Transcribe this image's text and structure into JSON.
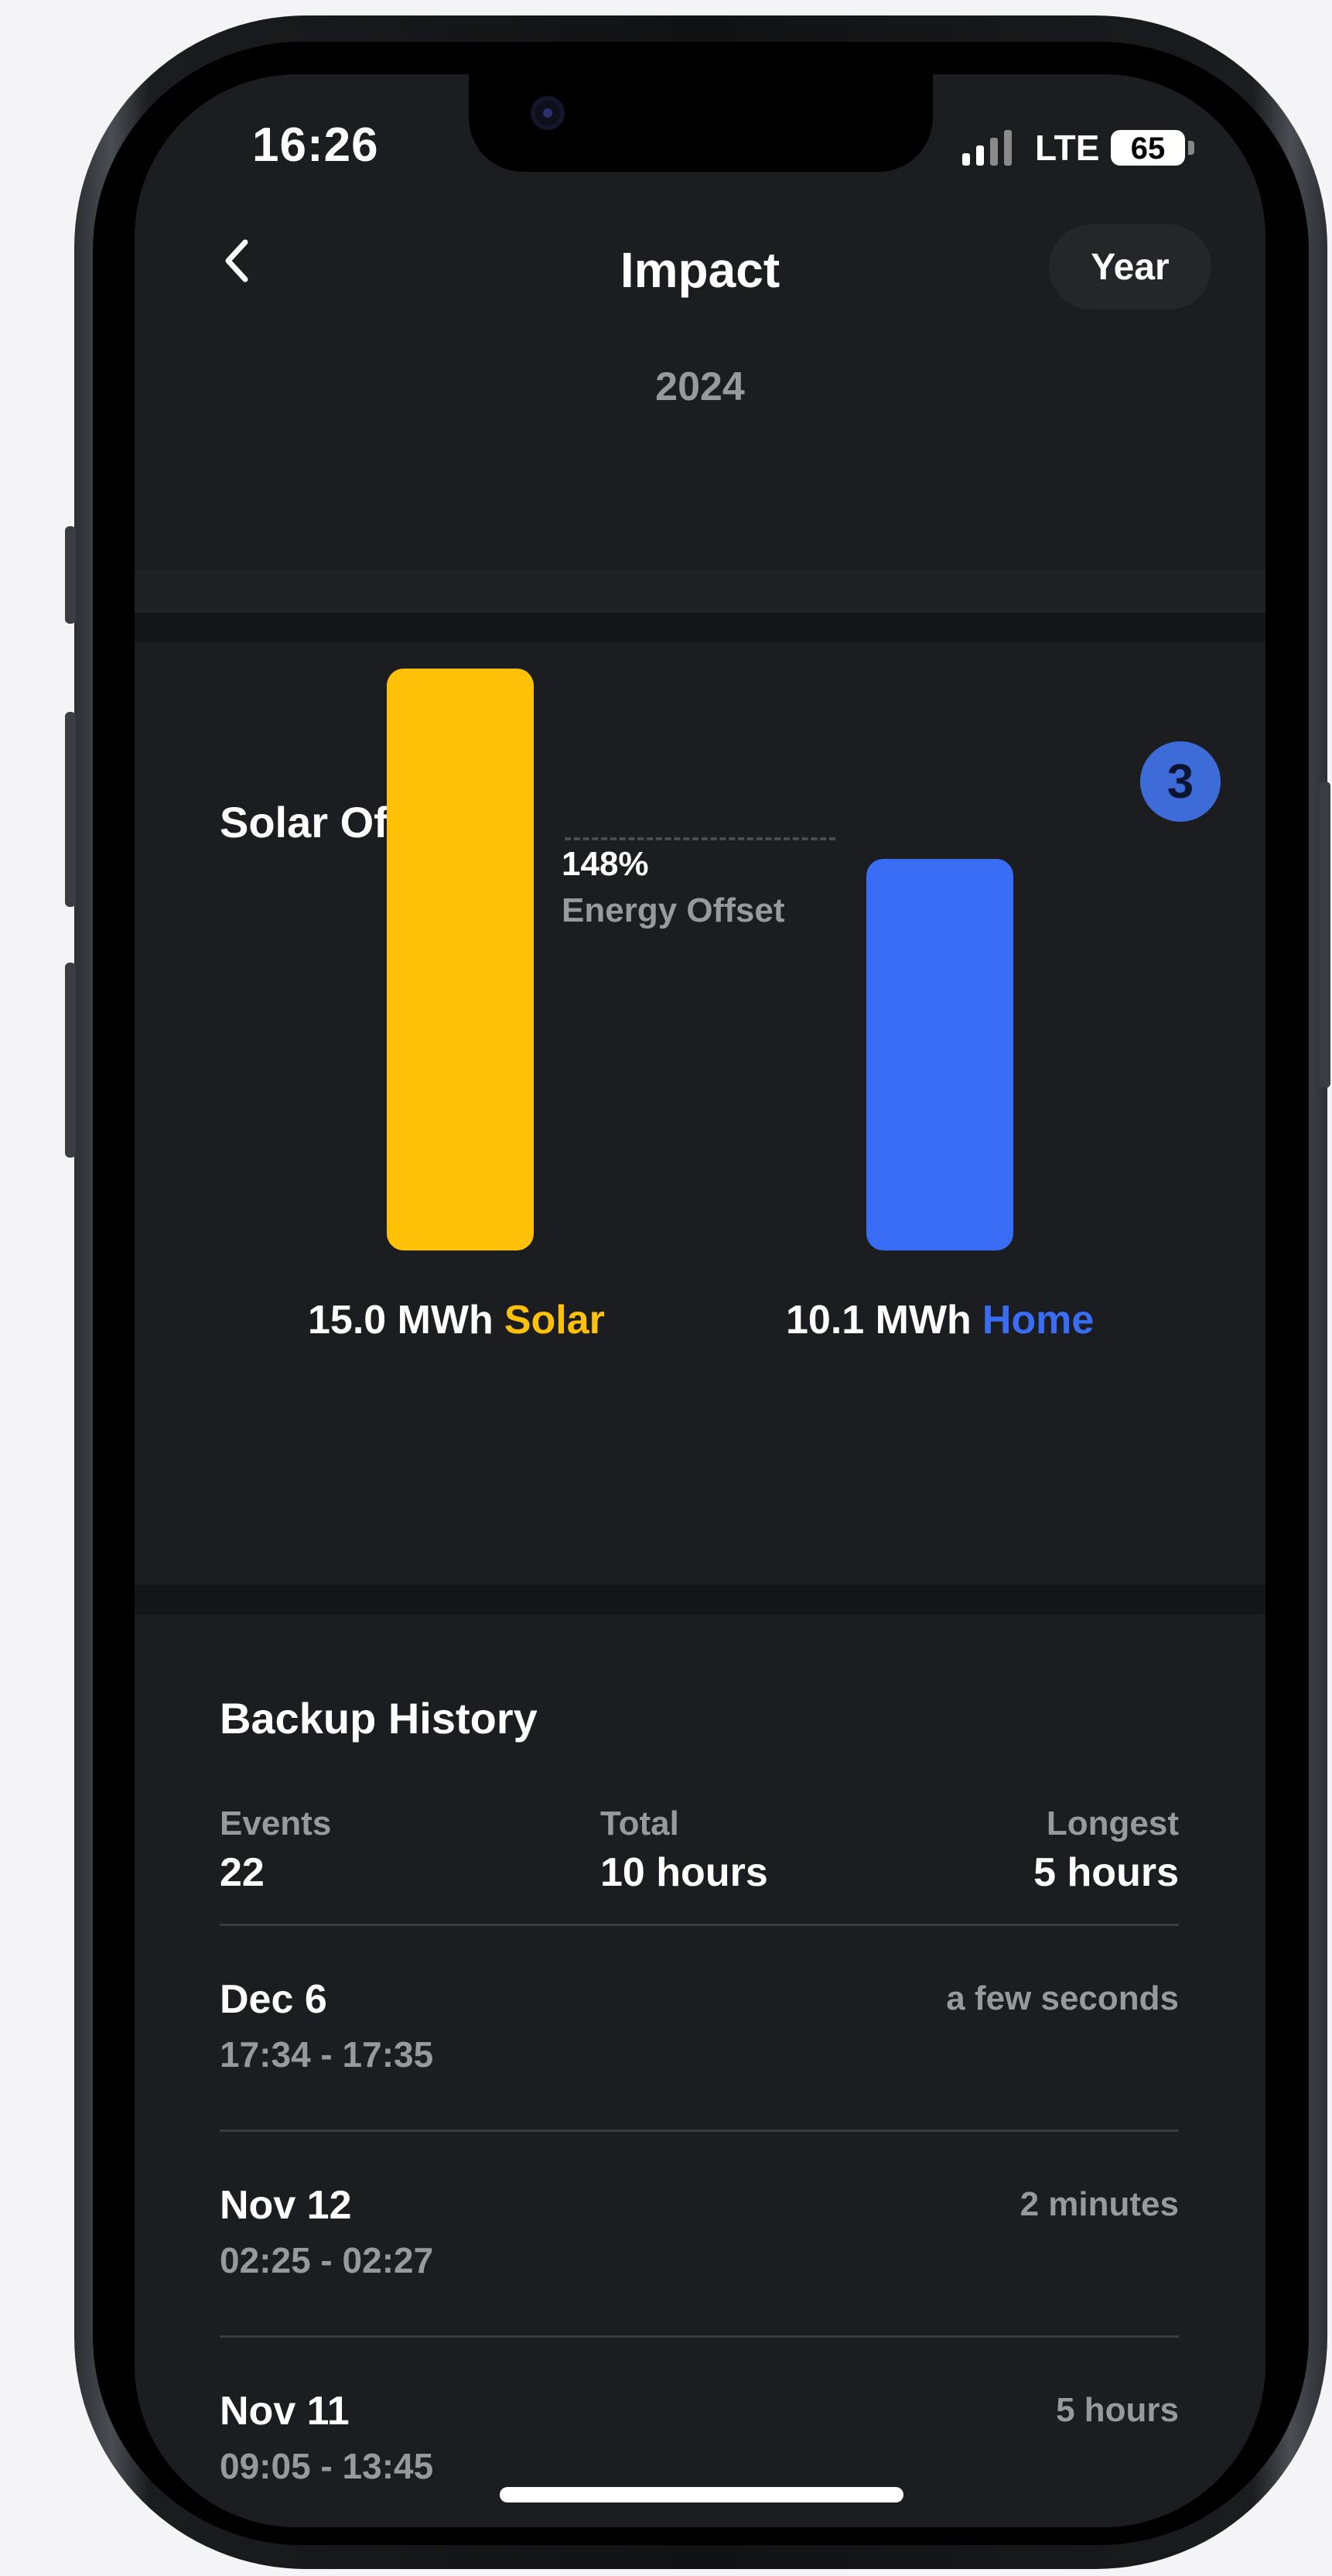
{
  "status_bar": {
    "time": "16:26",
    "network": "LTE",
    "battery": "65"
  },
  "header": {
    "title": "Impact",
    "period_button": "Year",
    "year": "2024"
  },
  "solar_offset": {
    "title": "Solar Offset",
    "badge": "3",
    "offset_percent": "148%",
    "offset_label": "Energy Offset",
    "solar_value": "15.0 MWh",
    "solar_label": "Solar",
    "home_value": "10.1 MWh",
    "home_label": "Home",
    "colors": {
      "solar": "#FFC107",
      "home": "#3A6DF6",
      "badge": "#3D6BD8"
    }
  },
  "chart_data": {
    "type": "bar",
    "categories": [
      "Solar",
      "Home"
    ],
    "values": [
      15.0,
      10.1
    ],
    "unit": "MWh",
    "colors": [
      "#FFC107",
      "#3A6DF6"
    ],
    "annotation": "148% Energy Offset"
  },
  "backup_history": {
    "title": "Backup History",
    "stats": [
      {
        "label": "Events",
        "value": "22"
      },
      {
        "label": "Total",
        "value": "10 hours"
      },
      {
        "label": "Longest",
        "value": "5 hours"
      }
    ],
    "events": [
      {
        "date": "Dec 6",
        "range": "17:34 - 17:35",
        "duration": "a few seconds"
      },
      {
        "date": "Nov 12",
        "range": "02:25 - 02:27",
        "duration": "2 minutes"
      },
      {
        "date": "Nov 11",
        "range": "09:05 - 13:45",
        "duration": "5 hours"
      }
    ]
  }
}
